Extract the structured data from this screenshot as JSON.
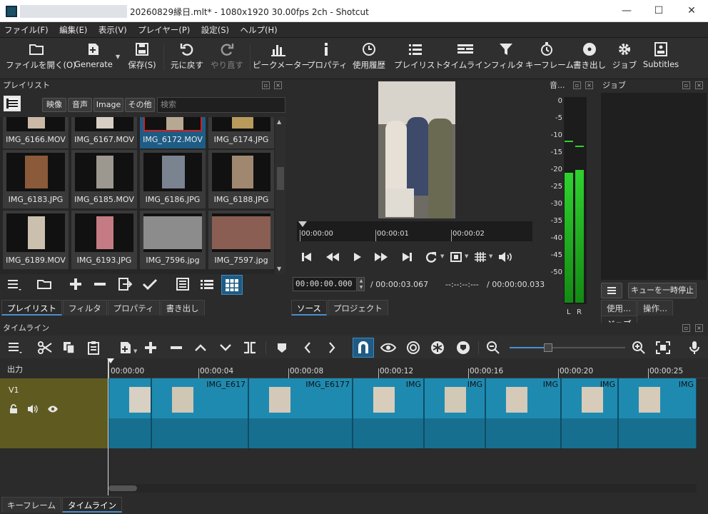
{
  "window": {
    "title": "20260829縁日.mlt* - 1080x1920 30.00fps 2ch - Shotcut",
    "minimize": "—",
    "maximize": "☐",
    "close": "✕"
  },
  "menu": [
    "ファイル(F)",
    "編集(E)",
    "表示(V)",
    "プレイヤー(P)",
    "設定(S)",
    "ヘルプ(H)"
  ],
  "toolbar": {
    "open": "ファイルを開く(O)",
    "generate": "Generate",
    "save": "保存(S)",
    "undo": "元に戻す",
    "redo": "やり直す",
    "peak": "ピークメーター",
    "properties": "プロパティ",
    "history": "使用履歴",
    "playlist": "プレイリスト",
    "timeline": "タイムライン",
    "filters": "フィルタ",
    "keyframes": "キーフレーム",
    "export": "書き出し",
    "jobs": "ジョブ",
    "subtitles": "Subtitles"
  },
  "playlist": {
    "title": "プレイリスト",
    "filters": [
      "映像",
      "音声",
      "Image",
      "その他"
    ],
    "search_placeholder": "検索",
    "items": [
      "IMG_6166.MOV",
      "IMG_6167.MOV",
      "IMG_6172.MOV",
      "IMG_6174.JPG",
      "IMG_6183.JPG",
      "IMG_6185.MOV",
      "IMG_6186.JPG",
      "IMG_6188.JPG",
      "IMG_6189.MOV",
      "IMG_6193.JPG",
      "IMG_7596.jpg",
      "IMG_7597.jpg"
    ],
    "tabs": [
      "プレイリスト",
      "フィルタ",
      "プロパティ",
      "書き出し"
    ]
  },
  "player": {
    "ruler": [
      "00:00:00",
      "00:00:01",
      "00:00:02"
    ],
    "timecode": "00:00:00.000",
    "duration": "/ 00:00:03.067",
    "in_point": "--:--:--:---",
    "selected": "/ 00:00:00.033",
    "tabs": [
      "ソース",
      "プロジェクト"
    ]
  },
  "meter": {
    "title": "音...",
    "scale": [
      "0",
      "-5",
      "-10",
      "-15",
      "-20",
      "-25",
      "-30",
      "-35",
      "-40",
      "-45",
      "-50"
    ],
    "left": "L",
    "right": "R",
    "level_left_db": -20.5,
    "level_right_db": -19.5,
    "peak_left_db": -11,
    "peak_right_db": -12.5
  },
  "jobs": {
    "title": "ジョブ",
    "pause_queue": "キューを一時停止",
    "tabs": [
      "使用...",
      "操作...",
      "ジョブ"
    ]
  },
  "timeline": {
    "title": "タイムライン",
    "output": "出力",
    "track": "V1",
    "ruler": [
      "00:00:00",
      "00:00:04",
      "00:00:08",
      "00:00:12",
      "00:00:16",
      "00:00:20",
      "00:00:25"
    ],
    "clips": [
      "",
      "IMG_E617",
      "IMG_E6177",
      "IMG",
      "IMG",
      "IMG",
      "IMG",
      "IMG"
    ],
    "tabs": [
      "キーフレーム",
      "タイムライン"
    ]
  },
  "colors": {
    "accent": "#4a8fd0",
    "clip": "#1f8ab0",
    "track_head": "#5f5a20",
    "meter_green": "#1fa31f"
  }
}
